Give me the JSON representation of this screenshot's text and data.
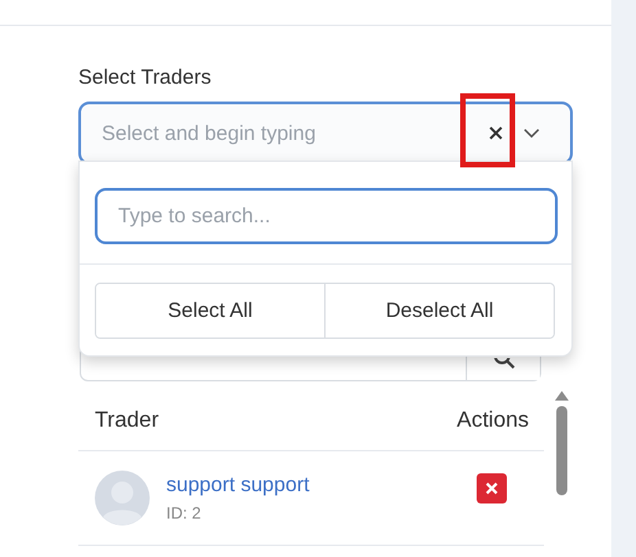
{
  "form": {
    "label": "Select Traders",
    "select": {
      "placeholder": "Select and begin typing",
      "expanded": true,
      "clear_highlighted": true
    },
    "dropdown": {
      "search": {
        "placeholder": "Type to search..."
      },
      "buttons": [
        "Select All",
        "Deselect All"
      ]
    },
    "table": {
      "columns": [
        "Trader",
        "Actions"
      ],
      "rows": [
        {
          "name": "support support",
          "id": "ID: 2"
        }
      ]
    }
  }
}
